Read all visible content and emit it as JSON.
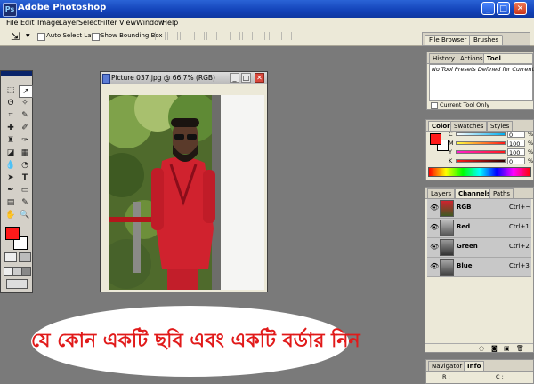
{
  "window": {
    "title": "Adobe Photoshop",
    "icon_text": "Ps"
  },
  "menu": {
    "items": [
      "File",
      "Edit",
      "Image",
      "Layer",
      "Select",
      "Filter",
      "View",
      "Window",
      "Help"
    ]
  },
  "options": {
    "auto_select_label": "Auto Select Layer",
    "bounding_box_label": "Show Bounding Box",
    "dock_tabs": [
      "File Browser",
      "Brushes"
    ]
  },
  "document": {
    "title": "Picture 037.jpg @ 66.7% (RGB)"
  },
  "tool_presets_panel": {
    "tabs": [
      "History",
      "Actions",
      "Tool Presets"
    ],
    "message": "No Tool Presets Defined for Current Tool",
    "checkbox_label": "Current Tool Only"
  },
  "color_panel": {
    "tabs": [
      "Color",
      "Swatches",
      "Styles"
    ],
    "channels": [
      {
        "label": "C",
        "value": "0",
        "unit": "%"
      },
      {
        "label": "M",
        "value": "100",
        "unit": "%"
      },
      {
        "label": "Y",
        "value": "100",
        "unit": "%"
      },
      {
        "label": "K",
        "value": "0",
        "unit": "%"
      }
    ]
  },
  "layers_panel": {
    "tabs": [
      "Layers",
      "Channels",
      "Paths"
    ],
    "channels": [
      {
        "name": "RGB",
        "shortcut": "Ctrl+~"
      },
      {
        "name": "Red",
        "shortcut": "Ctrl+1"
      },
      {
        "name": "Green",
        "shortcut": "Ctrl+2"
      },
      {
        "name": "Blue",
        "shortcut": "Ctrl+3"
      }
    ]
  },
  "navigator_panel": {
    "tabs": [
      "Navigator",
      "Info"
    ],
    "labels": [
      "R :",
      "C :"
    ]
  },
  "overlay": {
    "text": "যে কোন একটি ছবি এবং একটি বর্ডার নিন"
  },
  "colors": {
    "foreground": "#ff1a1a",
    "background": "#ffffff",
    "titlebar": "#1f55cc"
  },
  "icons": {
    "move_tool": "move-arrow-icon",
    "eye": "eye-icon"
  }
}
